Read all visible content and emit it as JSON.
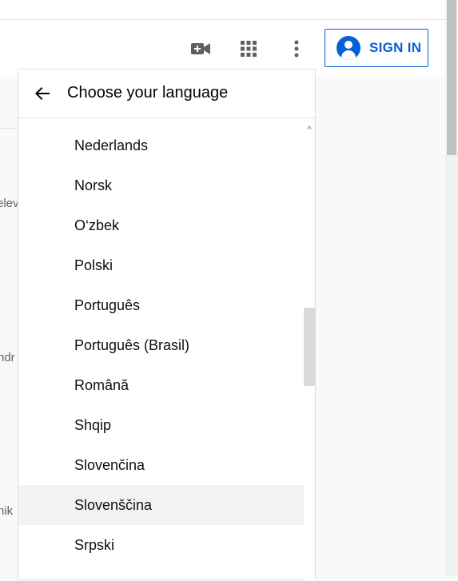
{
  "header": {
    "sign_in_label": "SIGN IN",
    "icons": [
      "create-video-icon",
      "apps-grid-icon",
      "more-vert-icon",
      "account-circle-icon"
    ]
  },
  "background": {
    "snippets": [
      "elev",
      "ndr",
      "nik"
    ]
  },
  "language_panel": {
    "title": "Choose your language",
    "items": [
      {
        "label": "Nederlands"
      },
      {
        "label": "Norsk"
      },
      {
        "label": "O‘zbek"
      },
      {
        "label": "Polski"
      },
      {
        "label": "Português"
      },
      {
        "label": "Português (Brasil)"
      },
      {
        "label": "Română"
      },
      {
        "label": "Shqip"
      },
      {
        "label": "Slovenčina"
      },
      {
        "label": "Slovenščina"
      },
      {
        "label": "Srpski"
      }
    ],
    "hovered_item": "Slovenščina"
  },
  "colors": {
    "accent": "#065fd4",
    "icon": "#606060",
    "text": "#0f0f0f",
    "hover": "#f2f2f2"
  }
}
